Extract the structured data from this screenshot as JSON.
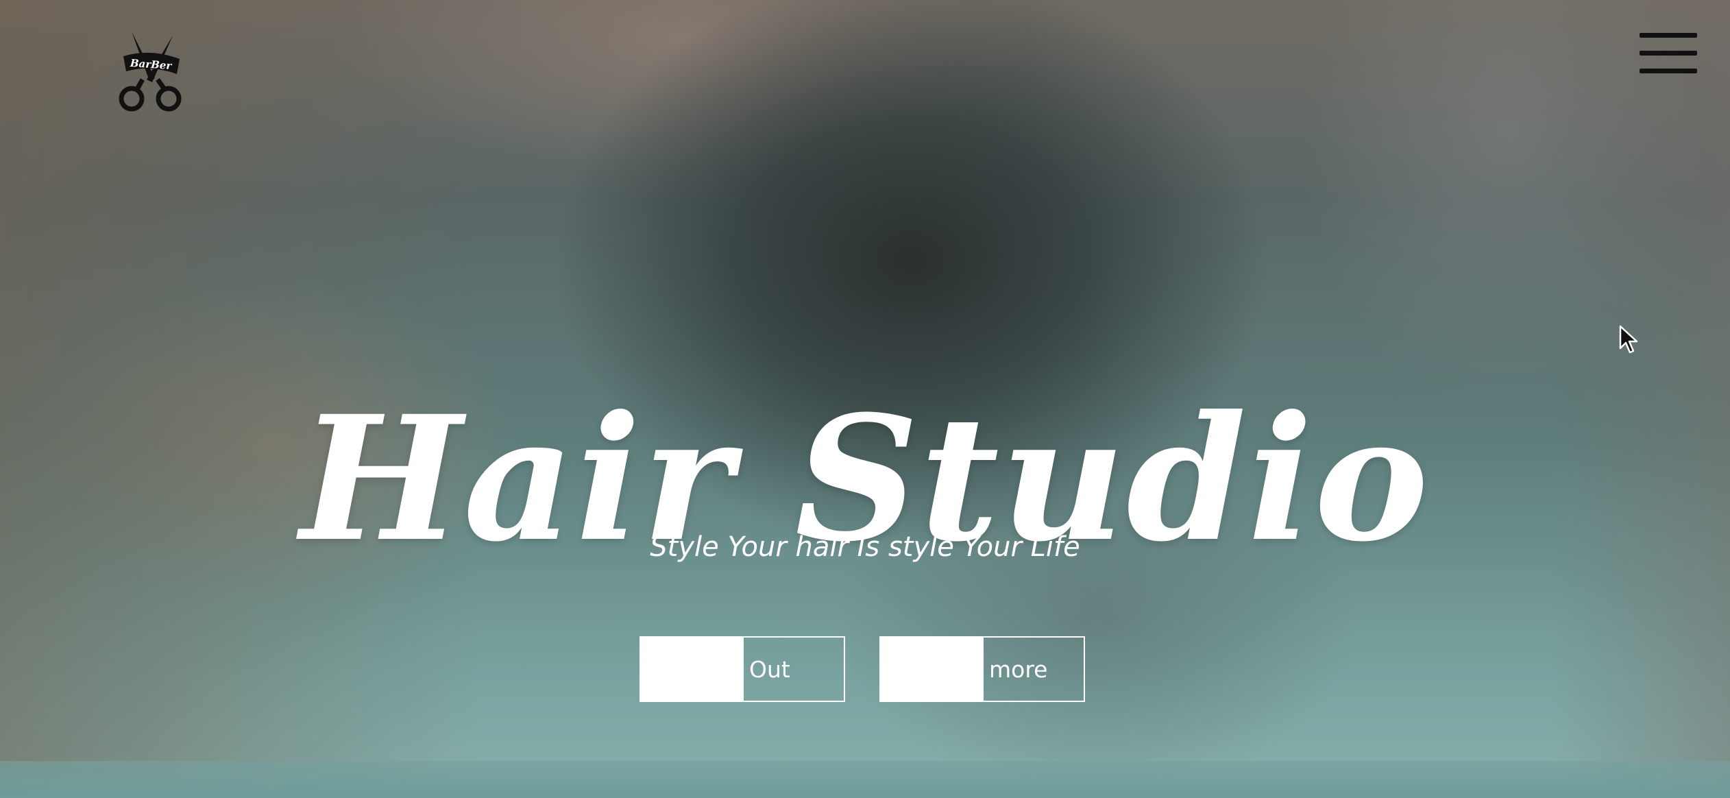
{
  "header": {
    "logo_text": "BarBer",
    "menu_icon": "hamburger-menu-icon"
  },
  "hero": {
    "title": "Hair Studio",
    "subtitle": "Style Your hair Is style Your Life",
    "buttons": [
      {
        "label": "Out"
      },
      {
        "label": "more"
      }
    ]
  },
  "colors": {
    "text": "#ffffff",
    "menu_icon": "#111111",
    "background_tint": "#5e7d7b"
  }
}
